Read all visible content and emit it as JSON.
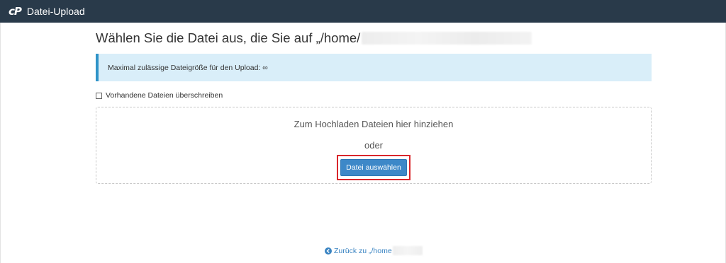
{
  "header": {
    "logo_text": "cP",
    "title": "Datei-Upload"
  },
  "main": {
    "heading": "Wählen Sie die Datei aus, die Sie auf „/home/",
    "max_size_notice": "Maximal zulässige Dateigröße für den Upload: ∞",
    "overwrite_label": "Vorhandene Dateien überschreiben",
    "overwrite_checked": false,
    "dropzone": {
      "drag_text": "Zum Hochladen Dateien hier hinziehen",
      "or_text": "oder",
      "choose_button_label": "Datei auswählen"
    },
    "back_link_text": "Zurück zu „/home"
  },
  "icons": {
    "back": "arrow-circle-left-icon"
  },
  "colors": {
    "topbar": "#293a4a",
    "alert_bg": "#d9eef9",
    "alert_border": "#2f93c8",
    "button": "#3d88c8",
    "highlight": "#d9262b",
    "link": "#3a84c2"
  }
}
